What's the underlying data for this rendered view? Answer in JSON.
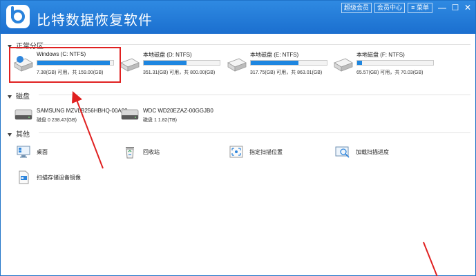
{
  "app": {
    "title": "比特数据恢复软件",
    "buttons": {
      "super_vip": "超级会员",
      "vip_center": "会员中心",
      "menu": "菜单"
    },
    "window_controls": {
      "minimize": "—",
      "maximize": "☐",
      "close": "✕"
    }
  },
  "partitions": {
    "label": "正常分区",
    "items": [
      {
        "name": "Windows (C: NTFS)",
        "info": "7.38(GB) 可用，共 159.00(GB)",
        "used_fraction": 0.95
      },
      {
        "name": "本地磁盘 (D: NTFS)",
        "info": "351.31(GB) 可用，共 800.00(GB)",
        "used_fraction": 0.56
      },
      {
        "name": "本地磁盘 (E: NTFS)",
        "info": "317.75(GB) 可用，共 863.01(GB)",
        "used_fraction": 0.63
      },
      {
        "name": "本地磁盘 (F: NTFS)",
        "info": "65.57(GB) 可用，共 70.03(GB)",
        "used_fraction": 0.06
      }
    ]
  },
  "disks": {
    "label": "磁盘",
    "items": [
      {
        "name": "SAMSUNG MZVLB256HBHQ-00A00",
        "info": "磁盘 0    238.47(GB)"
      },
      {
        "name": "WDC WD20EZAZ-00GGJB0",
        "info": "磁盘 1    1.82(TB)"
      }
    ]
  },
  "others": {
    "label": "其他",
    "items": [
      {
        "label": "桌面",
        "icon": "desktop-icon"
      },
      {
        "label": "回收站",
        "icon": "recycle-bin-icon"
      },
      {
        "label": "指定扫描位置",
        "icon": "scan-location-icon"
      },
      {
        "label": "加载扫描进度",
        "icon": "load-progress-icon"
      },
      {
        "label": "扫描存储设备镜像",
        "icon": "device-image-icon"
      }
    ]
  },
  "colors": {
    "titlebar": "#1b6fcf",
    "accent": "#1e86e0",
    "highlight": "#e02020"
  }
}
